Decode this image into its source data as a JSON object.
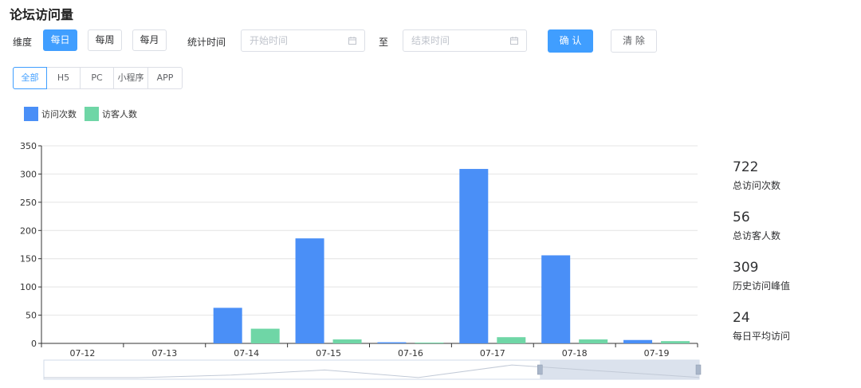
{
  "title": "论坛访问量",
  "filters": {
    "dimension_label": "维度",
    "dimension_options": [
      "每日",
      "每周",
      "每月"
    ],
    "dimension_selected": "每日",
    "time_label": "统计时间",
    "start_placeholder": "开始时间",
    "to_label": "至",
    "end_placeholder": "结束时间",
    "confirm_label": "确 认",
    "clear_label": "清 除"
  },
  "platforms": {
    "options": [
      "全部",
      "H5",
      "PC",
      "小程序",
      "APP"
    ],
    "selected": "全部"
  },
  "colors": {
    "accent": "#409eff",
    "visits": "#4a8ff7",
    "visitors": "#6fd6a6"
  },
  "chart_data": {
    "type": "bar",
    "categories": [
      "07-12",
      "07-13",
      "07-14",
      "07-15",
      "07-16",
      "07-17",
      "07-18",
      "07-19"
    ],
    "series": [
      {
        "name": "访问次数",
        "values": [
          0,
          0,
          63,
          186,
          2,
          309,
          156,
          6
        ]
      },
      {
        "name": "访客人数",
        "values": [
          0,
          0,
          26,
          7,
          1,
          11,
          7,
          4
        ]
      }
    ],
    "ylim": [
      0,
      350
    ],
    "yticks": [
      "0",
      "50",
      "100",
      "150",
      "200",
      "250",
      "300",
      "350"
    ],
    "grid": true,
    "legend_position": "top-left",
    "datazoom_range": [
      0.757,
      1.0
    ]
  },
  "stats": [
    {
      "value": "722",
      "label": "总访问次数"
    },
    {
      "value": "56",
      "label": "总访客人数"
    },
    {
      "value": "309",
      "label": "历史访问峰值"
    },
    {
      "value": "24",
      "label": "每日平均访问"
    }
  ]
}
